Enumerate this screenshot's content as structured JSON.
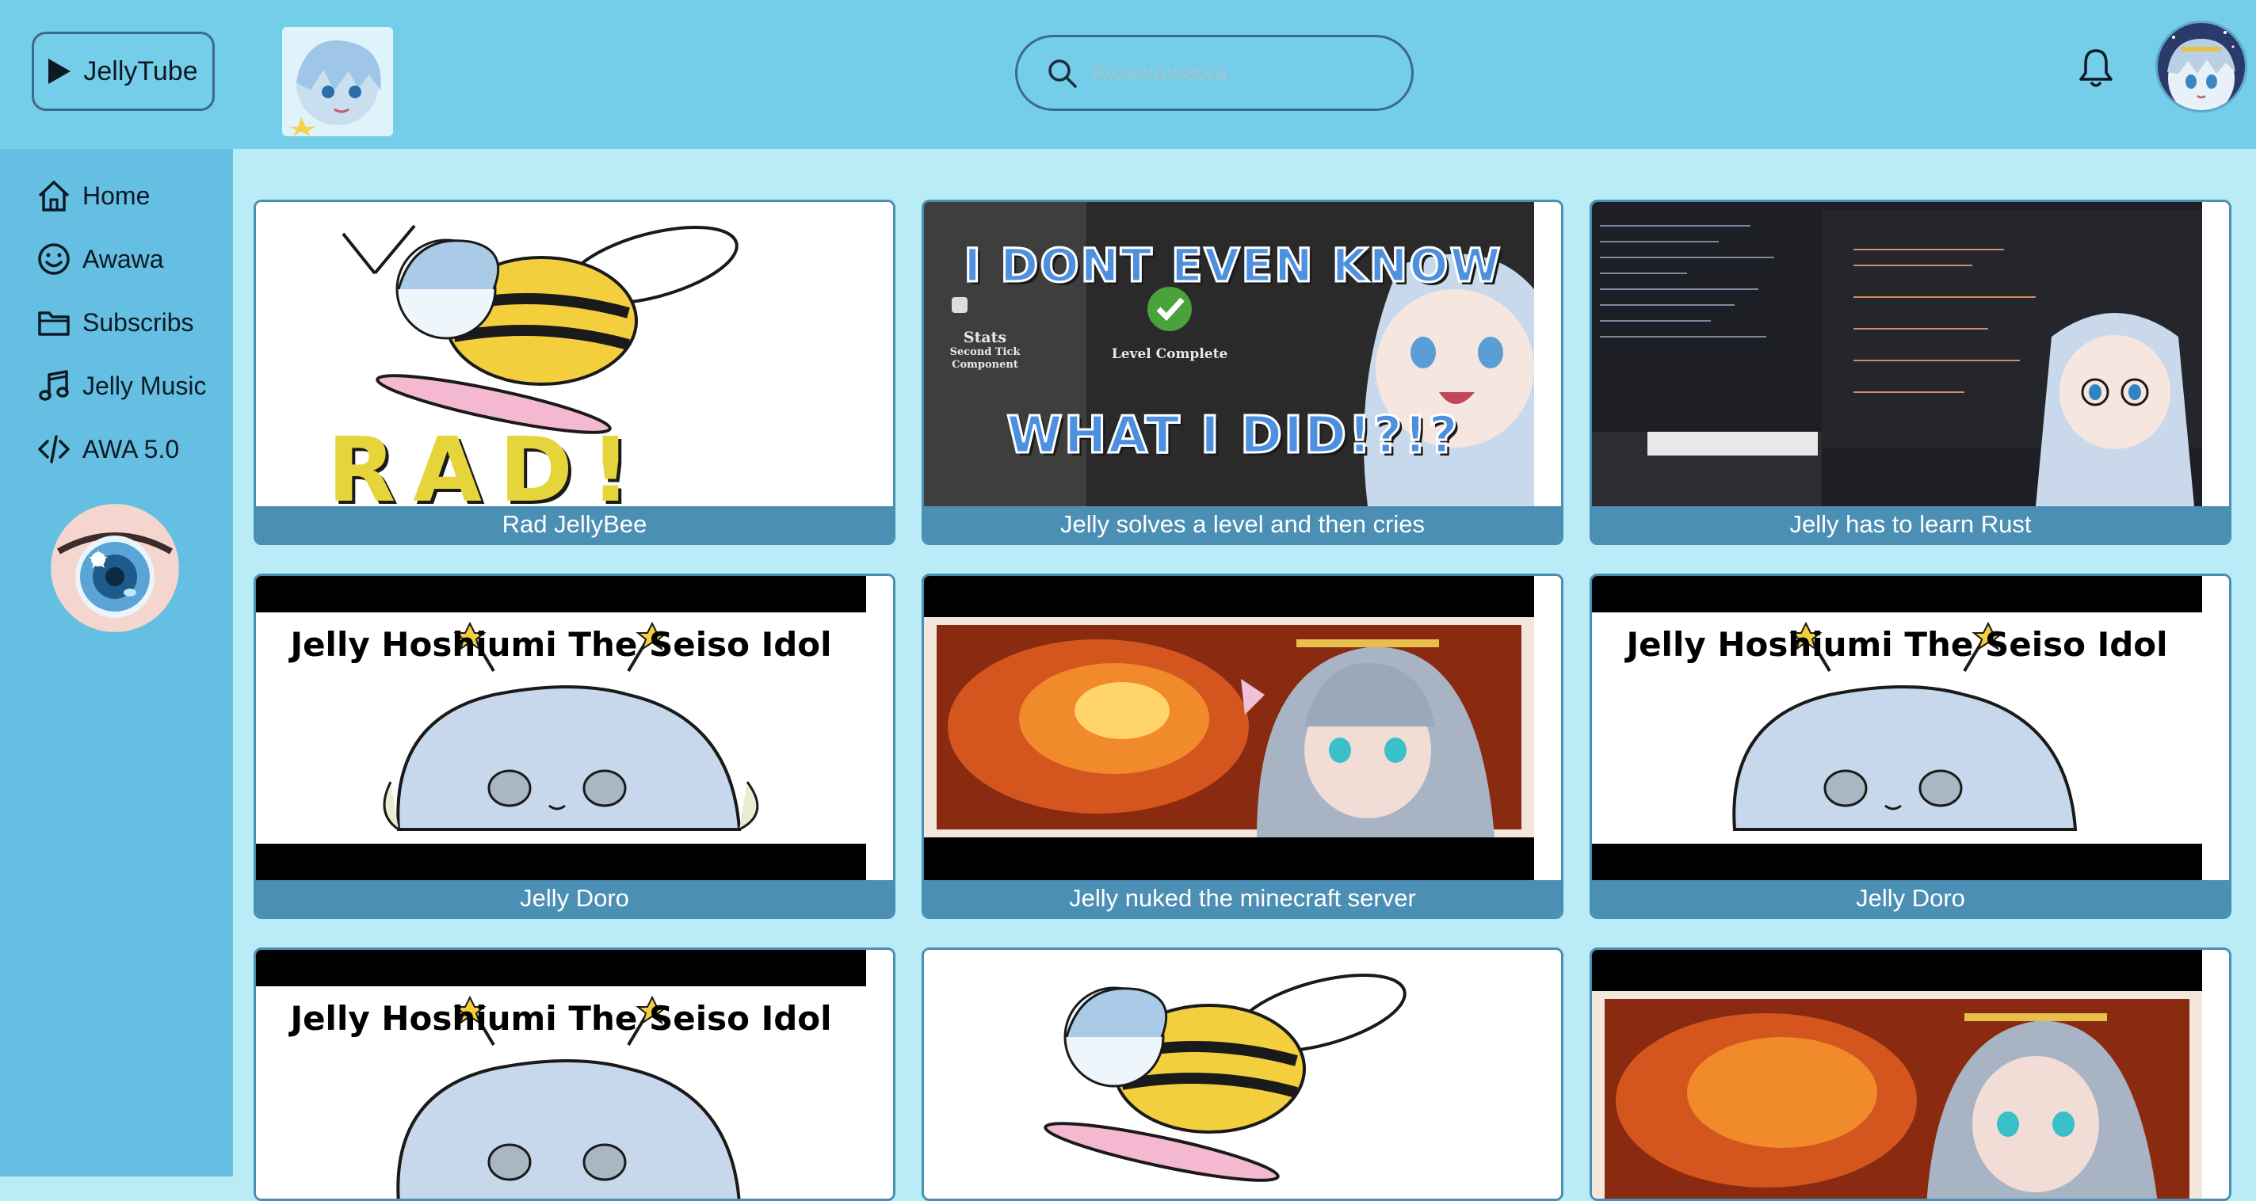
{
  "header": {
    "brand_label": "JellyTube",
    "search_placeholder": "Awawawawa"
  },
  "sidebar": {
    "items": [
      {
        "label": "Home",
        "icon": "home-icon"
      },
      {
        "label": "Awawa",
        "icon": "smile-icon"
      },
      {
        "label": "Subscribs",
        "icon": "folder-icon"
      },
      {
        "label": "Jelly Music",
        "icon": "music-note-icon"
      },
      {
        "label": "AWA 5.0",
        "icon": "code-icon"
      }
    ]
  },
  "videos": [
    {
      "title": "Rad JellyBee",
      "thumb_text": "RAD!"
    },
    {
      "title": "Jelly solves a level and then cries",
      "thumb_top": "I DONT EVEN KNOW",
      "thumb_bottom": "WHAT I DID!?!?",
      "thumb_small": [
        "Stats",
        "Second Tick",
        "Component",
        "Level Complete"
      ]
    },
    {
      "title": "Jelly has to learn Rust"
    },
    {
      "title": "Jelly Doro",
      "thumb_text": "Jelly Hoshiumi The Seiso Idol"
    },
    {
      "title": "Jelly nuked the minecraft server"
    },
    {
      "title": "Jelly Doro",
      "thumb_text": "Jelly Hoshiumi The Seiso Idol"
    },
    {
      "title": "",
      "thumb_text": "Jelly Hoshiumi The Seiso Idol"
    },
    {
      "title": ""
    },
    {
      "title": ""
    }
  ],
  "colors": {
    "header_bg": "#74cde9",
    "sidebar_bg": "#65bfe2",
    "content_bg": "#b9ecf7",
    "caption_bg": "#4b8fb5",
    "border": "#3d6a86"
  }
}
